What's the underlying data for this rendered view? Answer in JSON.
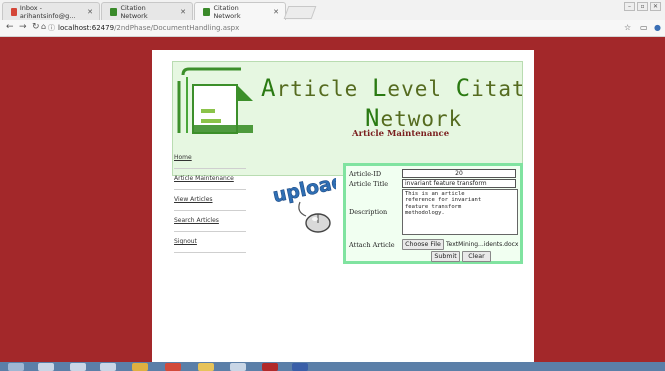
{
  "browser": {
    "tabs": [
      {
        "label": "Inbox - arihantsinfo@g…",
        "favicon_color": "#d44638"
      },
      {
        "label": "Citation Network",
        "favicon_color": "#3a8a2a"
      },
      {
        "label": "Citation Network",
        "favicon_color": "#3a8a2a"
      }
    ],
    "url_host": "localhost:62479",
    "url_path": "/2ndPhase/DocumentHandling.aspx"
  },
  "banner": {
    "line1_caps": [
      "A",
      "L",
      "C"
    ],
    "line1_rest": [
      "rticle ",
      "evel ",
      "itation"
    ],
    "line2_cap": "N",
    "line2_rest": "etwork"
  },
  "section_title": "Article Maintenance",
  "menu": {
    "items": [
      "Home",
      "Article Maintenance",
      "View Articles",
      "Search Articles",
      "Signout"
    ]
  },
  "upload_graphic_text": "upload",
  "form": {
    "article_id_label": "Article-ID",
    "article_id_value": "20",
    "article_title_label": "Article Title",
    "article_title_value": "invariant feature transform",
    "description_label": "Description",
    "description_value": "This is an article\nreference for invariant\nfeature transform\nmethodology.",
    "attach_label": "Attach Article",
    "choose_file_label": "Choose File",
    "file_name": "TextMining...idents.docx",
    "submit_label": "Submit",
    "clear_label": "Clear"
  },
  "colors": {
    "page_background": "#a3282a",
    "banner_background": "#e6f7e1",
    "form_border": "#80e3a0",
    "title_color": "#7a1e1e"
  }
}
